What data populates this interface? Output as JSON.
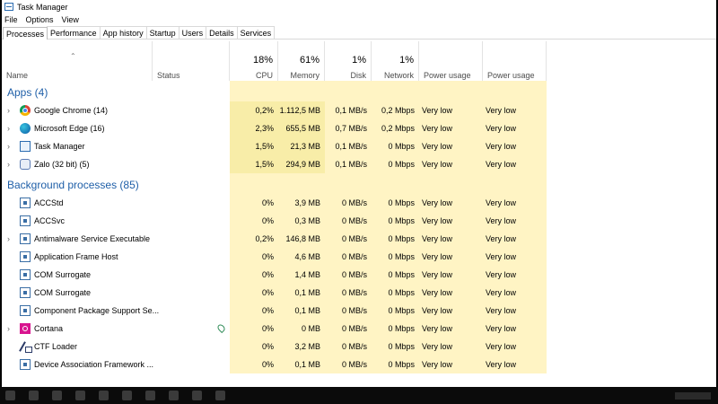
{
  "window": {
    "title": "Task Manager"
  },
  "menu": [
    "File",
    "Options",
    "View"
  ],
  "tabs": [
    "Processes",
    "Performance",
    "App history",
    "Startup",
    "Users",
    "Details",
    "Services"
  ],
  "header": {
    "name": "Name",
    "status": "Status",
    "cpu": {
      "pct": "18%",
      "label": "CPU"
    },
    "memory": {
      "pct": "61%",
      "label": "Memory"
    },
    "disk": {
      "pct": "1%",
      "label": "Disk"
    },
    "network": {
      "pct": "1%",
      "label": "Network"
    },
    "power": "Power usage",
    "power_trend": "Power usage tr..."
  },
  "groups": {
    "apps_title": "Apps (4)",
    "bg_title": "Background processes (85)"
  },
  "apps": [
    {
      "name": "Google Chrome (14)",
      "cpu": "0,2%",
      "memory": "1.112,5 MB",
      "disk": "0,1 MB/s",
      "network": "0,2 Mbps",
      "power": "Very low",
      "trend": "Very low",
      "icon": "chrome-icon"
    },
    {
      "name": "Microsoft Edge (16)",
      "cpu": "2,3%",
      "memory": "655,5 MB",
      "disk": "0,7 MB/s",
      "network": "0,2 Mbps",
      "power": "Very low",
      "trend": "Very low",
      "icon": "edge-icon"
    },
    {
      "name": "Task Manager",
      "cpu": "1,5%",
      "memory": "21,3 MB",
      "disk": "0,1 MB/s",
      "network": "0 Mbps",
      "power": "Very low",
      "trend": "Very low",
      "icon": "task-manager-icon"
    },
    {
      "name": "Zalo (32 bit) (5)",
      "cpu": "1,5%",
      "memory": "294,9 MB",
      "disk": "0,1 MB/s",
      "network": "0 Mbps",
      "power": "Very low",
      "trend": "Very low",
      "icon": "zalo-icon"
    }
  ],
  "background": [
    {
      "name": "ACCStd",
      "cpu": "0%",
      "memory": "3,9 MB",
      "disk": "0 MB/s",
      "network": "0 Mbps",
      "power": "Very low",
      "trend": "Very low",
      "icon": "service-icon"
    },
    {
      "name": "ACCSvc",
      "cpu": "0%",
      "memory": "0,3 MB",
      "disk": "0 MB/s",
      "network": "0 Mbps",
      "power": "Very low",
      "trend": "Very low",
      "icon": "service-icon"
    },
    {
      "name": "Antimalware Service Executable",
      "cpu": "0,2%",
      "memory": "146,8 MB",
      "disk": "0 MB/s",
      "network": "0 Mbps",
      "power": "Very low",
      "trend": "Very low",
      "icon": "service-icon"
    },
    {
      "name": "Application Frame Host",
      "cpu": "0%",
      "memory": "4,6 MB",
      "disk": "0 MB/s",
      "network": "0 Mbps",
      "power": "Very low",
      "trend": "Very low",
      "icon": "service-icon"
    },
    {
      "name": "COM Surrogate",
      "cpu": "0%",
      "memory": "1,4 MB",
      "disk": "0 MB/s",
      "network": "0 Mbps",
      "power": "Very low",
      "trend": "Very low",
      "icon": "service-icon"
    },
    {
      "name": "COM Surrogate",
      "cpu": "0%",
      "memory": "0,1 MB",
      "disk": "0 MB/s",
      "network": "0 Mbps",
      "power": "Very low",
      "trend": "Very low",
      "icon": "service-icon"
    },
    {
      "name": "Component Package Support Se...",
      "cpu": "0%",
      "memory": "0,1 MB",
      "disk": "0 MB/s",
      "network": "0 Mbps",
      "power": "Very low",
      "trend": "Very low",
      "icon": "service-icon"
    },
    {
      "name": "Cortana",
      "cpu": "0%",
      "memory": "0 MB",
      "disk": "0 MB/s",
      "network": "0 Mbps",
      "power": "Very low",
      "trend": "Very low",
      "icon": "cortana-icon"
    },
    {
      "name": "CTF Loader",
      "cpu": "0%",
      "memory": "3,2 MB",
      "disk": "0 MB/s",
      "network": "0 Mbps",
      "power": "Very low",
      "trend": "Very low",
      "icon": "ctf-loader-icon"
    },
    {
      "name": "Device Association Framework ...",
      "cpu": "0%",
      "memory": "0,1 MB",
      "disk": "0 MB/s",
      "network": "0 Mbps",
      "power": "Very low",
      "trend": "Very low",
      "icon": "service-icon"
    }
  ],
  "colors": {
    "group_title": "#1f5fa8",
    "highlight": "#fff4c4",
    "highlight_strong": "#f8eda8"
  }
}
